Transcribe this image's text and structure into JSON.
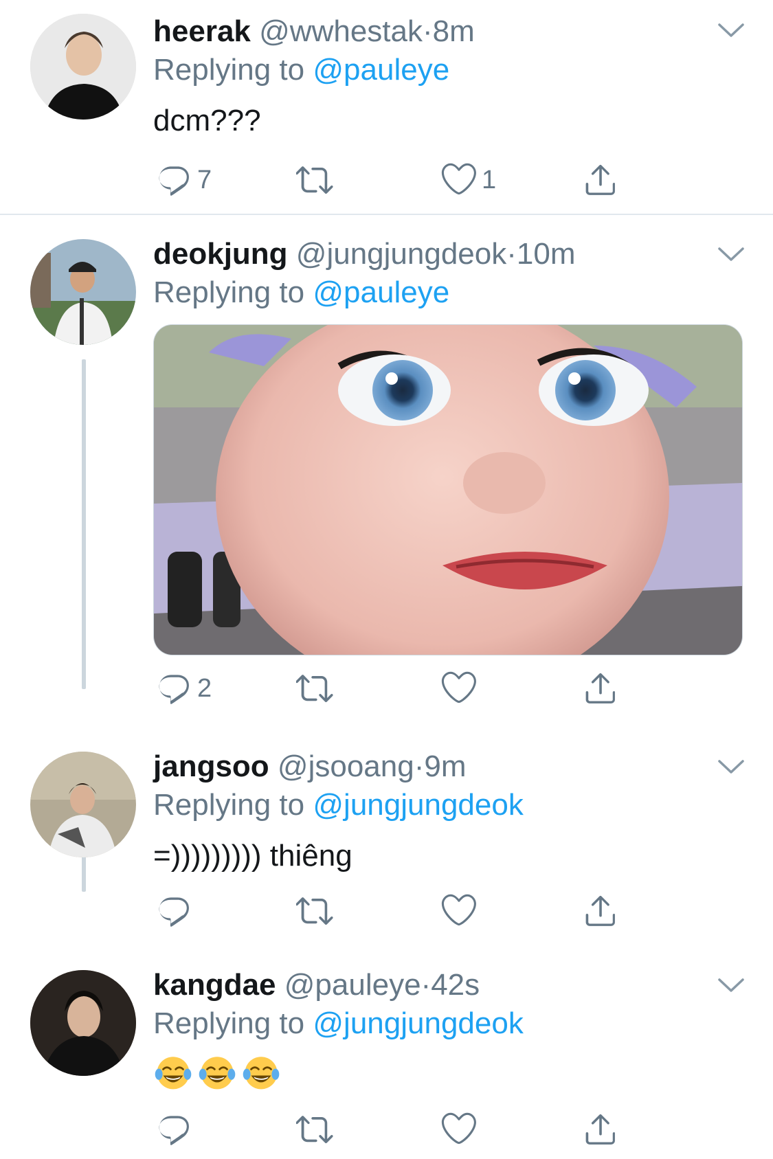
{
  "tweets": [
    {
      "name": "heerak",
      "handle": "@wwhestak",
      "time": "8m",
      "replying_prefix": "Replying to",
      "replying_to": "@pauleye",
      "text": "dcm???",
      "reply_count": "7",
      "retweet_count": "",
      "like_count": "1"
    },
    {
      "name": "deokjung",
      "handle": "@jungjungdeok",
      "time": "10m",
      "replying_prefix": "Replying to",
      "replying_to": "@pauleye",
      "text": "",
      "media": "cartoon-face-image",
      "reply_count": "2",
      "retweet_count": "",
      "like_count": ""
    },
    {
      "name": "jangsoo",
      "handle": "@jsooang",
      "time": "9m",
      "replying_prefix": "Replying to",
      "replying_to": "@jungjungdeok",
      "text": "=))))))))) thiêng",
      "reply_count": "",
      "retweet_count": "",
      "like_count": ""
    },
    {
      "name": "kangdae",
      "handle": "@pauleye",
      "time": "42s",
      "replying_prefix": "Replying to",
      "replying_to": "@jungjungdeok",
      "text": "",
      "emoji": [
        "face-with-tears-of-joy",
        "face-with-tears-of-joy",
        "face-with-tears-of-joy"
      ],
      "reply_count": "",
      "retweet_count": "",
      "like_count": ""
    }
  ],
  "separator": "·",
  "icons": [
    "reply-icon",
    "retweet-icon",
    "like-icon",
    "share-icon",
    "chevron-down-icon"
  ],
  "colors": {
    "link": "#1da1f2",
    "muted": "#657786",
    "text": "#14171a",
    "thread_line": "#ccd6dd"
  }
}
